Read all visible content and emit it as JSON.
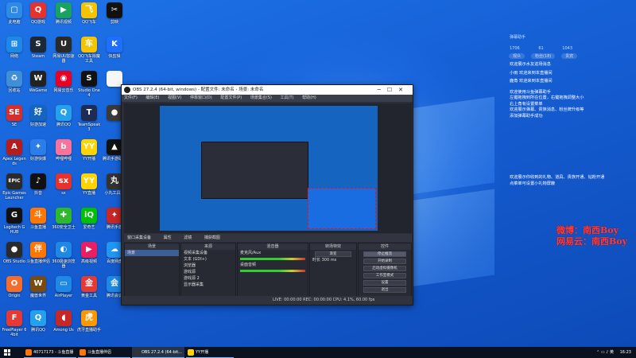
{
  "desktop_icons": [
    {
      "label": "此电脑",
      "color": "#2d8ae6",
      "glyph": "▢"
    },
    {
      "label": "QQ游戏",
      "color": "#e5322d",
      "glyph": "Q"
    },
    {
      "label": "腾讯视频",
      "color": "#1aa260",
      "glyph": "▶"
    },
    {
      "label": "QQ飞车",
      "color": "#f5c400",
      "glyph": "飞"
    },
    {
      "label": "剪映",
      "color": "#111111",
      "glyph": "✂"
    },
    {
      "label": "网络",
      "color": "#1e88e5",
      "glyph": "⊞"
    },
    {
      "label": "Steam",
      "color": "#1b2838",
      "glyph": "S"
    },
    {
      "label": "网易UU加速器",
      "color": "#2a2a2a",
      "glyph": "U"
    },
    {
      "label": "QQ飞车除魔工具",
      "color": "#f5c400",
      "glyph": "车"
    },
    {
      "label": "快剪辑",
      "color": "#1e6fff",
      "glyph": "K"
    },
    {
      "label": "回收站",
      "color": "#3f8ed8",
      "glyph": "♻"
    },
    {
      "label": "WeGame",
      "color": "#222222",
      "glyph": "W"
    },
    {
      "label": "网易云音乐",
      "color": "#e60026",
      "glyph": "◉"
    },
    {
      "label": "Studio One 4",
      "color": "#111111",
      "glyph": "S"
    },
    {
      "label": "",
      "color": "#f7f7f7",
      "glyph": ""
    },
    {
      "label": "SE",
      "color": "#d32f2f",
      "glyph": "SE"
    },
    {
      "label": "好游加速",
      "color": "#1565c0",
      "glyph": "好"
    },
    {
      "label": "腾讯QQ",
      "color": "#24a0ed",
      "glyph": "Q"
    },
    {
      "label": "TeamSpeak 3",
      "color": "#1d2b55",
      "glyph": "T"
    },
    {
      "label": "",
      "color": "#3a3a3a",
      "glyph": "●"
    },
    {
      "label": "Apex Legends",
      "color": "#b71c1c",
      "glyph": "A"
    },
    {
      "label": "好游快爆",
      "color": "#2b7de9",
      "glyph": "✦"
    },
    {
      "label": "哔哩哔哩",
      "color": "#fb7299",
      "glyph": "b"
    },
    {
      "label": "YY开播",
      "color": "#ffd400",
      "glyph": "YY"
    },
    {
      "label": "腾讯手游助手",
      "color": "#111111",
      "glyph": "▲"
    },
    {
      "label": "Epic Games Launcher",
      "color": "#2a2a2a",
      "glyph": "EPIC"
    },
    {
      "label": "抖音",
      "color": "#111111",
      "glyph": "♪"
    },
    {
      "label": "sx",
      "color": "#e5322d",
      "glyph": "sx"
    },
    {
      "label": "YY直播",
      "color": "#ffd400",
      "glyph": "YY"
    },
    {
      "label": "小丸工具箱",
      "color": "#333333",
      "glyph": "丸"
    },
    {
      "label": "Logitech G HUB",
      "color": "#111111",
      "glyph": "G"
    },
    {
      "label": "斗鱼直播",
      "color": "#ff7700",
      "glyph": "斗"
    },
    {
      "label": "360安全卫士",
      "color": "#2eb82e",
      "glyph": "✚"
    },
    {
      "label": "爱奇艺",
      "color": "#00be06",
      "glyph": "iQ"
    },
    {
      "label": "腾讯手游",
      "color": "#c62828",
      "glyph": "✦"
    },
    {
      "label": "OBS Studio",
      "color": "#2a2a2a",
      "glyph": "●"
    },
    {
      "label": "斗鱼直播伴侣",
      "color": "#ff7700",
      "glyph": "伴"
    },
    {
      "label": "360极速浏览器",
      "color": "#1e88e5",
      "glyph": "◐"
    },
    {
      "label": "高级视频",
      "color": "#e91e63",
      "glyph": "▶"
    },
    {
      "label": "百度网盘",
      "color": "#2196f3",
      "glyph": "☁"
    },
    {
      "label": "Origin",
      "color": "#f56c2d",
      "glyph": "O"
    },
    {
      "label": "魔兽世界",
      "color": "#7a4a10",
      "glyph": "W"
    },
    {
      "label": "AirPlayer",
      "color": "#1e88e5",
      "glyph": "▭"
    },
    {
      "label": "黄金工具",
      "color": "#e53935",
      "glyph": "金"
    },
    {
      "label": "腾讯会议",
      "color": "#1e88e5",
      "glyph": "会"
    },
    {
      "label": "FreePlayer 64bit",
      "color": "#e53935",
      "glyph": "F"
    },
    {
      "label": "腾讯QQ",
      "color": "#24a0ed",
      "glyph": "Q"
    },
    {
      "label": "Among Us",
      "color": "#c62828",
      "glyph": "◖"
    },
    {
      "label": "虎牙直播助手",
      "color": "#ff9800",
      "glyph": "虎"
    }
  ],
  "obs": {
    "title": "OBS 27.2.4 (64-bit, windows) - 配置文件: 未命名 - 场景: 未命名",
    "menu": [
      "文件(F)",
      "编辑(E)",
      "视图(V)",
      "停靠窗口(D)",
      "配置文件(P)",
      "场景集合(S)",
      "工具(T)",
      "帮助(H)"
    ],
    "source_bar": [
      "窗口采集设备",
      "属性",
      "滤镜",
      "捕获截图"
    ],
    "docks": {
      "scenes": {
        "title": "场景",
        "items": [
          "场景"
        ]
      },
      "sources": {
        "title": "来源",
        "items": [
          "视频采集设备",
          "文本 (GDI+)",
          "浏览器",
          "游戏源",
          "游戏源 2",
          "显示器采集"
        ]
      },
      "mixer": {
        "title": "混音器",
        "items": [
          "麦克风/Aux",
          "桌面音频"
        ]
      },
      "transitions": {
        "title": "转场特效",
        "mode": "渐变",
        "duration_label": "时长",
        "duration": "300 ms"
      },
      "controls": {
        "title": "控件",
        "buttons": [
          "停止推流",
          "开始录制",
          "启动虚拟摄像机",
          "工作室模式",
          "设置",
          "退出"
        ]
      }
    },
    "status": "LIVE: 00:00:00   REC: 00:00:00   CPU: 4.1%, 60.00 fps"
  },
  "chat": {
    "header": "弹幕助手",
    "stats": [
      "1706",
      "61",
      "1043"
    ],
    "tabs": [
      "观众",
      "粉丝(18)",
      "贵宾"
    ],
    "lines": [
      "欢迎展示水友进场消息",
      "小雨 欢迎来到本直播间",
      "鹿角 欢迎来到本直播间",
      "欢迎使用斗鱼弹幕助手",
      "左键拖拽到所在位置，右键拖拽调整大小",
      "右上角有设置菜单",
      "欢迎展示弹幕、贵族消息、粉丝牌升级等",
      "添加弹幕助手成功",
      "欢迎展示你收到的礼物、道具、贵族开通、钻粉开通",
      "点菜单可设置小礼物屏蔽"
    ]
  },
  "credit": {
    "line1": "微博：南西Boy",
    "line2": "网易云：南西Boy"
  },
  "taskbar": {
    "items": [
      {
        "label": "40717173 - 斗鱼直播",
        "color": "#ff7700"
      },
      {
        "label": "斗鱼直播伴侣",
        "color": "#ff7700"
      },
      {
        "label": "OBS 27.2.4 (64-bit...",
        "color": "#333333"
      },
      {
        "label": "YY开播",
        "color": "#ffd400"
      }
    ],
    "time": "16:23"
  }
}
